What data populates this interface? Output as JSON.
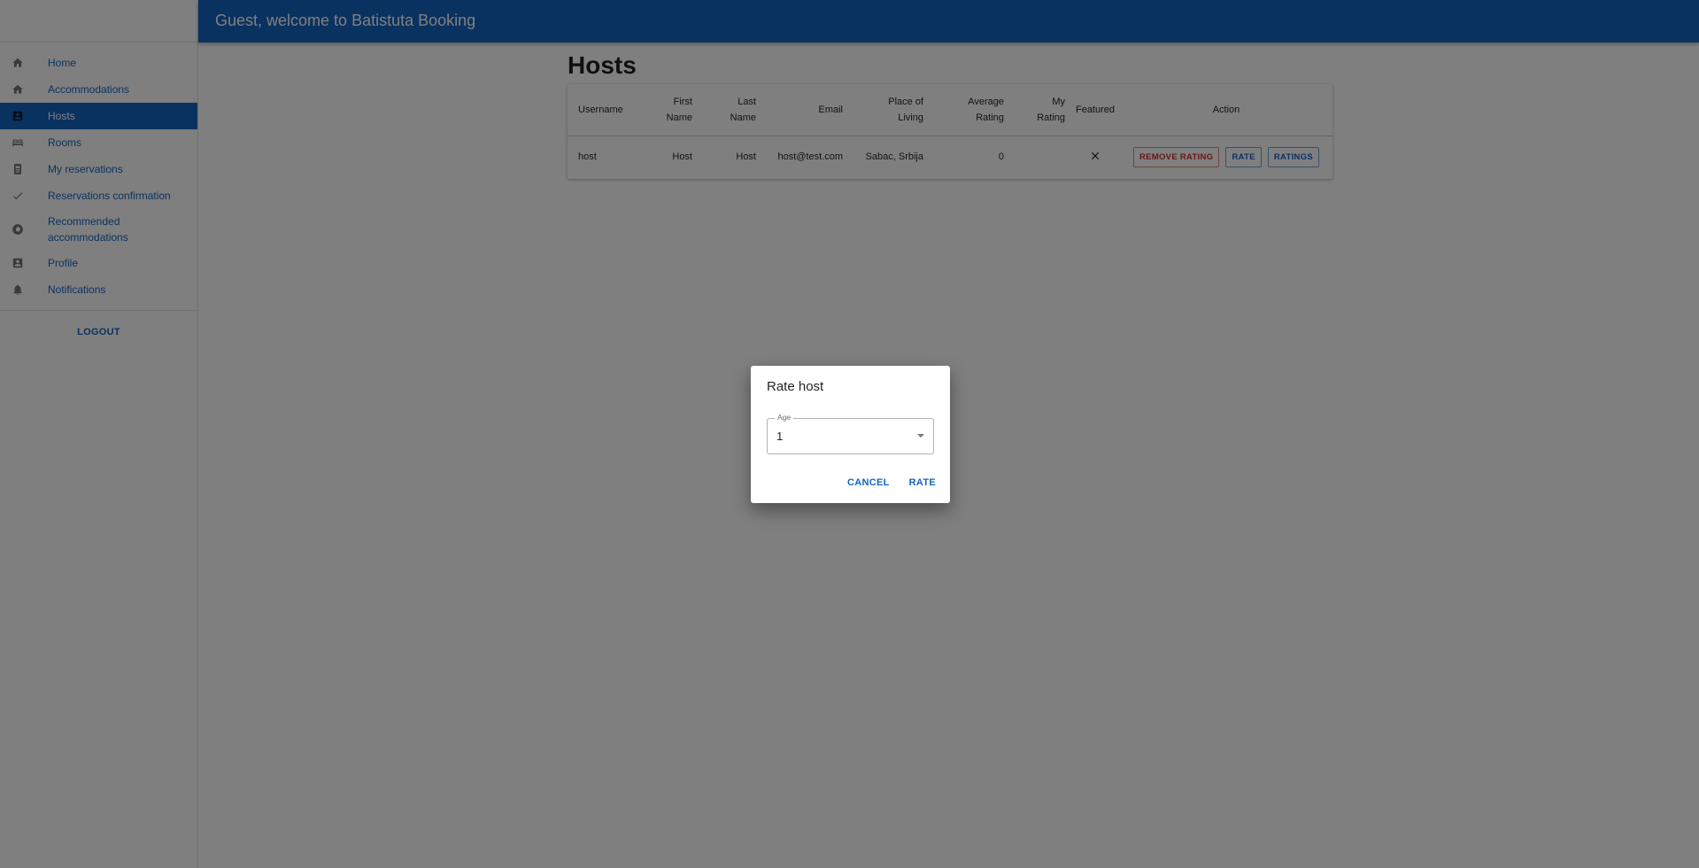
{
  "header": {
    "title": "Guest, welcome to Batistuta Booking"
  },
  "sidebar": {
    "items": [
      {
        "label": "Home",
        "icon": "home-icon"
      },
      {
        "label": "Accommodations",
        "icon": "home-icon"
      },
      {
        "label": "Hosts",
        "icon": "contact-card-icon",
        "active": true
      },
      {
        "label": "Rooms",
        "icon": "bed-icon"
      },
      {
        "label": "My reservations",
        "icon": "receipt-icon"
      },
      {
        "label": "Reservations confirmation",
        "icon": "check-icon"
      },
      {
        "label": "Recommended accommodations",
        "icon": "recommend-icon"
      },
      {
        "label": "Profile",
        "icon": "contact-card-icon"
      },
      {
        "label": "Notifications",
        "icon": "bell-icon"
      }
    ],
    "logout_label": "LOGOUT"
  },
  "main": {
    "title": "Hosts",
    "table": {
      "headers": {
        "username": "Username",
        "first_name_1": "First",
        "first_name_2": "Name",
        "last_name_1": "Last",
        "last_name_2": "Name",
        "email": "Email",
        "place_1": "Place of",
        "place_2": "Living",
        "avg_1": "Average",
        "avg_2": "Rating",
        "my_1": "My",
        "my_2": "Rating",
        "featured": "Featured",
        "action": "Action"
      },
      "rows": [
        {
          "username": "host",
          "first_name": "Host",
          "last_name": "Host",
          "email": "host@test.com",
          "place": "Sabac, Srbija",
          "average_rating": "0",
          "my_rating": "",
          "featured_icon": "close-icon",
          "actions": {
            "remove": "REMOVE RATING",
            "rate": "RATE",
            "ratings": "RATINGS"
          }
        }
      ]
    }
  },
  "dialog": {
    "title": "Rate host",
    "select_label": "Age",
    "select_value": "1",
    "cancel_label": "CANCEL",
    "confirm_label": "RATE"
  },
  "colors": {
    "primary": "#1565c0",
    "danger": "#d32f2f",
    "overlay": "rgba(0,0,0,0.5)"
  }
}
